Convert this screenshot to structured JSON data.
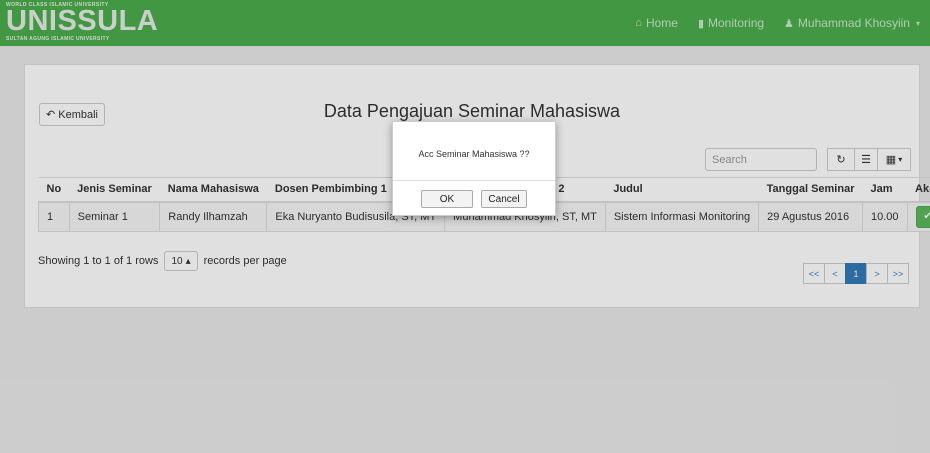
{
  "navbar": {
    "logo": {
      "top_text": "WORLD CLASS ISLAMIC UNIVERSITY",
      "main_text": "UNISSULA",
      "bottom_text": "SULTAN AGUNG ISLAMIC UNIVERSITY"
    },
    "items": [
      {
        "icon": "home-icon",
        "label": "Home"
      },
      {
        "icon": "file-icon",
        "label": "Monitoring"
      },
      {
        "icon": "user-icon",
        "label": "Muhammad Khosyiin"
      }
    ],
    "accent_color": "#4cae4c"
  },
  "panel": {
    "back_label": "Kembali",
    "title": "Data Pengajuan Seminar Mahasiswa",
    "search_placeholder": "Search"
  },
  "table": {
    "columns": [
      "No",
      "Jenis Seminar",
      "Nama Mahasiswa",
      "Dosen Pembimbing 1",
      "Dosen Pembimbing 2",
      "Judul",
      "Tanggal Seminar",
      "Jam",
      "Aksi"
    ],
    "rows": [
      {
        "no": "1",
        "jenis": "Seminar 1",
        "nama": "Randy Ilhamzah",
        "dosen1": "Eka Nuryanto Budisusila, ST, MT",
        "dosen2": "Muhammad Khosyiin, ST, MT",
        "judul": "Sistem Informasi Monitoring",
        "tanggal": "29 Agustus 2016",
        "jam": "10.00"
      }
    ]
  },
  "footer": {
    "showing": "Showing 1 to 1 of 1 rows",
    "page_size": "10",
    "records_per_page": "records per page",
    "pagination": [
      "<<",
      "<",
      "1",
      ">",
      ">>"
    ]
  },
  "dialog": {
    "message": "Acc Seminar Mahasiswa ??",
    "ok_label": "OK",
    "cancel_label": "Cancel"
  }
}
